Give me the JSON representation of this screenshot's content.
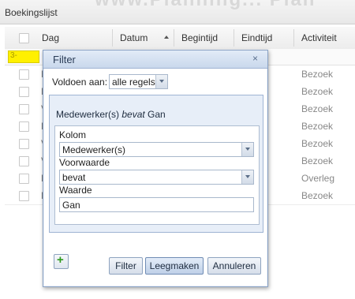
{
  "app": {
    "title": "Boekingslijst",
    "watermark": "www.Planning... Plan"
  },
  "grid": {
    "columns": [
      "Dag",
      "Datum",
      "Begintijd",
      "Eindtijd",
      "Activiteit"
    ],
    "sort_column": "Datum",
    "sort_direction": "ascending",
    "filter_indicator": "3-",
    "rows": [
      {
        "dag": "M",
        "activiteit": "Bezoek"
      },
      {
        "dag": "D",
        "activiteit": "Bezoek"
      },
      {
        "dag": "V",
        "activiteit": "Bezoek"
      },
      {
        "dag": "D",
        "activiteit": "Bezoek"
      },
      {
        "dag": "V",
        "activiteit": "Bezoek"
      },
      {
        "dag": "V",
        "activiteit": "Bezoek"
      },
      {
        "dag": "D",
        "activiteit": "Overleg"
      },
      {
        "dag": "D",
        "activiteit": "Bezoek"
      }
    ]
  },
  "dialog": {
    "title": "Filter",
    "close": "×",
    "match_label": "Voldoen aan:",
    "match_value": "alle regels",
    "group_prefix": "Medewerker(s) ",
    "group_operator": "bevat",
    "group_suffix": " Gan",
    "kolom_label": "Kolom",
    "kolom_value": "Medewerker(s)",
    "voorwaarde_label": "Voorwaarde",
    "voorwaarde_value": "bevat",
    "waarde_label": "Waarde",
    "waarde_value": "Gan",
    "add_symbol": "+",
    "buttons": {
      "filter": "Filter",
      "clear": "Leegmaken",
      "cancel": "Annuleren"
    }
  },
  "colors": {
    "highlight": "#fff000",
    "add_icon": "#2e9a1c",
    "dialog_border": "#8aa2c4"
  }
}
